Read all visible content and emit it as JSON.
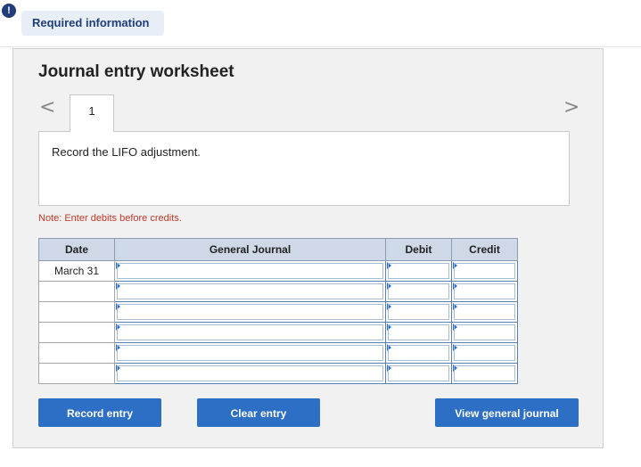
{
  "alert": {
    "icon": "exclamation-icon",
    "glyph": "!"
  },
  "required_tab": {
    "label": "Required information"
  },
  "worksheet": {
    "title": "Journal entry worksheet",
    "nav": {
      "prev_glyph": "<",
      "next_glyph": ">"
    },
    "page_tab": "1",
    "instruction": "Record the LIFO adjustment.",
    "note": "Note: Enter debits before credits."
  },
  "table": {
    "headers": {
      "date": "Date",
      "journal": "General Journal",
      "debit": "Debit",
      "credit": "Credit"
    },
    "rows": [
      {
        "date": "March 31"
      },
      {
        "date": ""
      },
      {
        "date": ""
      },
      {
        "date": ""
      },
      {
        "date": ""
      },
      {
        "date": ""
      }
    ]
  },
  "buttons": {
    "record": "Record entry",
    "clear": "Clear entry",
    "view": "View general journal"
  }
}
